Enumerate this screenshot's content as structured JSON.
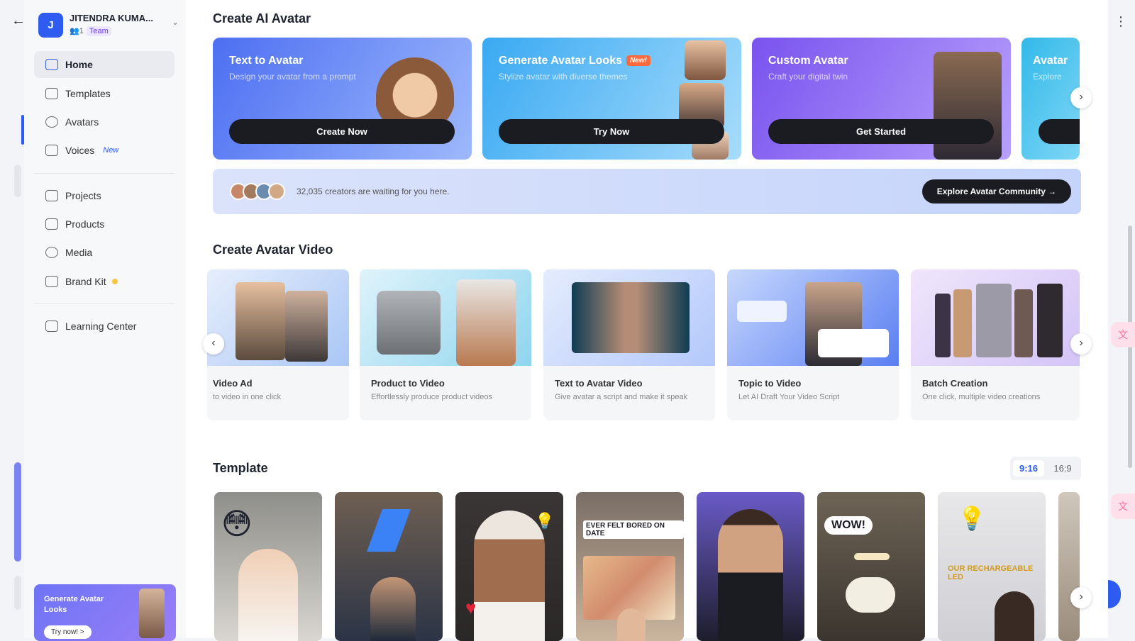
{
  "sidebar": {
    "account": {
      "initial": "J",
      "name": "JITENDRA KUMA...",
      "members": "1",
      "role": "Team"
    },
    "items": [
      {
        "label": "Home",
        "icon": "home-icon"
      },
      {
        "label": "Templates",
        "icon": "templates-icon"
      },
      {
        "label": "Avatars",
        "icon": "avatar-icon"
      },
      {
        "label": "Voices",
        "icon": "voices-icon",
        "badge": "New"
      },
      {
        "label": "Projects",
        "icon": "projects-icon"
      },
      {
        "label": "Products",
        "icon": "products-icon"
      },
      {
        "label": "Media",
        "icon": "media-icon"
      },
      {
        "label": "Brand Kit",
        "icon": "brand-kit-icon"
      },
      {
        "label": "Learning Center",
        "icon": "learning-center-icon"
      }
    ],
    "promo": {
      "title": "Generate Avatar Looks",
      "button": "Try now! >"
    }
  },
  "avatar_section": {
    "title": "Create AI Avatar",
    "cards": [
      {
        "title": "Text to Avatar",
        "subtitle": "Design your avatar from a prompt",
        "button": "Create Now"
      },
      {
        "title": "Generate Avatar Looks",
        "badge": "New!",
        "subtitle": "Stylize avatar with diverse themes",
        "button": "Try Now"
      },
      {
        "title": "Custom Avatar",
        "subtitle": "Craft your digital twin",
        "button": "Get Started"
      },
      {
        "title": "Avatar",
        "subtitle": "Explore"
      }
    ]
  },
  "community": {
    "text": "32,035 creators are waiting for you here.",
    "button": "Explore Avatar Community →"
  },
  "video_section": {
    "title": "Create Avatar Video",
    "cards": [
      {
        "title": "Video Ad",
        "subtitle": "to video in one click"
      },
      {
        "title": "Product to Video",
        "subtitle": "Effortlessly produce product videos"
      },
      {
        "title": "Text to Avatar Video",
        "subtitle": "Give avatar a script and make it speak"
      },
      {
        "title": "Topic to Video",
        "subtitle": "Let AI Draft Your Video Script"
      },
      {
        "title": "Batch Creation",
        "subtitle": "One click, multiple video creations"
      }
    ]
  },
  "template_section": {
    "title": "Template",
    "ratios": [
      "9:16",
      "16:9"
    ],
    "captions": [
      "EVER FELT BORED ON DATE",
      "WOW!",
      "OUR RECHARGEABLE LED"
    ]
  },
  "colors": {
    "accent": "#2f5cf0",
    "dark_button": "#1b1c22",
    "new_badge": "#ff6a3d"
  }
}
